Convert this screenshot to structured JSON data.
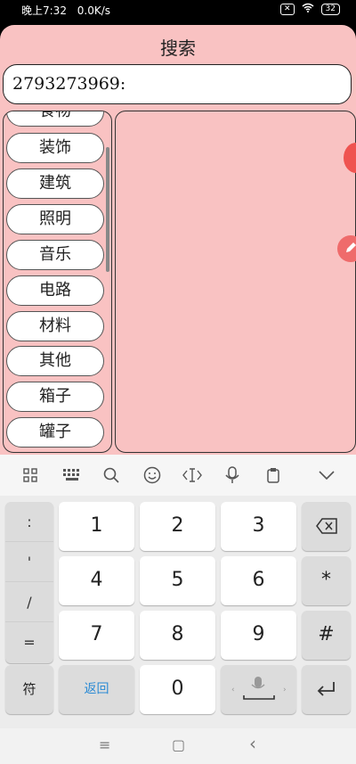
{
  "status_bar": {
    "time": "晚上7:32",
    "speed": "0.0K/s",
    "battery": "32"
  },
  "app": {
    "title": "搜索",
    "search_value": "2793273969:",
    "categories": [
      "食物",
      "装饰",
      "建筑",
      "照明",
      "音乐",
      "电路",
      "材料",
      "其他",
      "箱子",
      "罐子"
    ]
  },
  "keyboard": {
    "toolbar_icons": [
      "grid-icon",
      "keyboard-icon",
      "search-icon",
      "emoji-icon",
      "cursor-icon",
      "microphone-icon",
      "clipboard-icon",
      "chevron-down-icon"
    ],
    "symbols": [
      ":",
      "'",
      "/",
      "="
    ],
    "rows": [
      [
        "1",
        "2",
        "3"
      ],
      [
        "4",
        "5",
        "6"
      ],
      [
        "7",
        "8",
        "9"
      ]
    ],
    "right_keys": [
      "*",
      "#"
    ],
    "fu_label": "符",
    "back_label": "返回",
    "zero": "0"
  },
  "nav": {
    "menu": "≡",
    "home": "▢",
    "back": "‹"
  }
}
